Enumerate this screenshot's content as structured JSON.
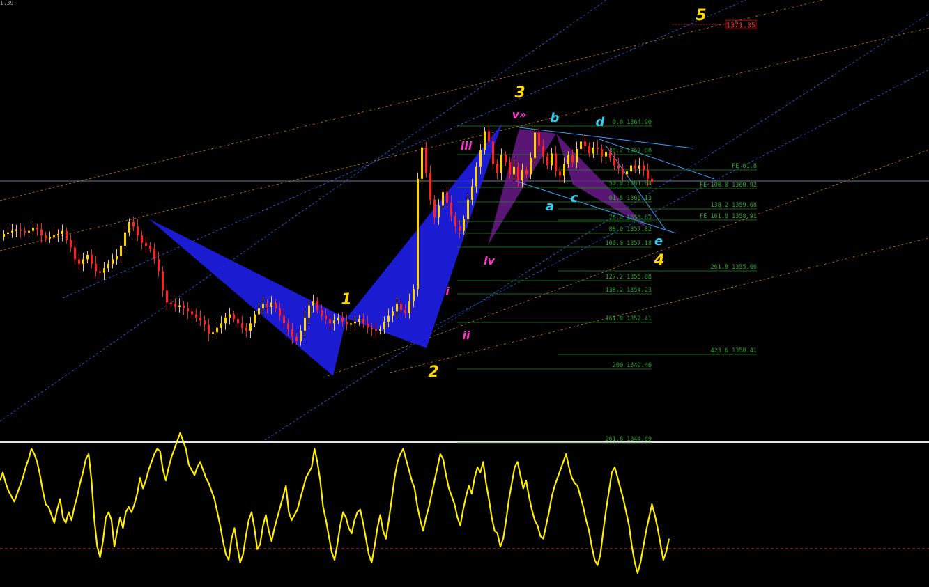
{
  "top_left_text": "1.39",
  "price_marker": {
    "label": "1371.35",
    "color": "#c00000"
  },
  "colors": {
    "background": "#000000",
    "bull_candle": "#ffd200",
    "bear_candle": "#ff2020",
    "fib_line": "#1f8a1f",
    "fib_text": "#2aa62a",
    "channel_blue": "#1f6fff",
    "channel_orange": "#c97a1a",
    "triangle_blue": "#1e1ee8",
    "triangle_purple": "#6a1a8a",
    "wave_major": "#ffd700",
    "wave_minor": "#ff33cc",
    "wave_abc": "#33ccee",
    "oscillator": "#ffee00",
    "oscillator_zero": "#c0306a"
  },
  "wave_labels": {
    "major": [
      "1",
      "2",
      "3",
      "4",
      "5"
    ],
    "minor": [
      "i",
      "ii",
      "iii",
      "iv",
      "v»"
    ],
    "abcde": [
      "a",
      "b",
      "c",
      "d",
      "e"
    ]
  },
  "fib_levels_left": [
    "0.0 1364.90",
    "38.2 1362.08",
    "50.0 1361.04",
    "61.8 1360.13",
    "76.4 1358.83",
    "88.6 1357.82",
    "100.0 1357.18",
    "127.2 1355.08",
    "138.2 1354.23",
    "161.8 1352.41",
    "200 1349.46",
    "261.8 1344.69"
  ],
  "fib_levels_right": [
    "FE 61.8",
    "FE 100.0 1360.92",
    "138.2 1359.68",
    "FE 161.8 1358.91",
    "261.8 1355.66",
    "423.6 1350.41"
  ],
  "chart_data": [
    {
      "type": "candlestick",
      "title": "",
      "xlabel": "",
      "ylabel": "",
      "ylim": [
        1343.6,
        1373.0
      ],
      "grid": false,
      "price_marker": 1371.35,
      "pivots": [
        {
          "label": "1",
          "value": 1352.8
        },
        {
          "label": "2",
          "value": 1349.9
        },
        {
          "label": "iii",
          "value": 1363.1
        },
        {
          "label": "v»",
          "value": 1364.9
        },
        {
          "label": "4",
          "value": 1357.18
        }
      ],
      "fib_retracement": [
        {
          "ratio": 0.0,
          "price": 1364.9
        },
        {
          "ratio": 38.2,
          "price": 1362.08
        },
        {
          "ratio": 50.0,
          "price": 1361.04
        },
        {
          "ratio": 61.8,
          "price": 1360.13
        },
        {
          "ratio": 76.4,
          "price": 1358.83
        },
        {
          "ratio": 88.6,
          "price": 1357.82
        },
        {
          "ratio": 100.0,
          "price": 1357.18
        },
        {
          "ratio": 127.2,
          "price": 1355.08
        },
        {
          "ratio": 138.2,
          "price": 1354.23
        },
        {
          "ratio": 161.8,
          "price": 1352.41
        },
        {
          "ratio": 200,
          "price": 1349.46
        },
        {
          "ratio": 261.8,
          "price": 1344.69
        }
      ],
      "fib_expansion": [
        {
          "ratio": 61.8,
          "price": null
        },
        {
          "ratio": 100.0,
          "price": 1360.92
        },
        {
          "ratio": 138.2,
          "price": 1359.68
        },
        {
          "ratio": 161.8,
          "price": 1358.91
        },
        {
          "ratio": 261.8,
          "price": 1355.66
        },
        {
          "ratio": 423.6,
          "price": 1350.41
        }
      ],
      "close_series": [
        1357.3,
        1357.4,
        1357.5,
        1357.6,
        1357.5,
        1357.4,
        1357.5,
        1357.7,
        1357.6,
        1357.2,
        1357.0,
        1357.1,
        1357.2,
        1357.3,
        1357.5,
        1356.9,
        1356.4,
        1355.6,
        1355.3,
        1355.6,
        1355.9,
        1355.3,
        1354.8,
        1354.7,
        1355.0,
        1355.3,
        1355.6,
        1355.8,
        1356.5,
        1357.4,
        1358.1,
        1357.8,
        1357.2,
        1356.7,
        1356.5,
        1356.3,
        1355.6,
        1354.8,
        1353.5,
        1352.7,
        1352.6,
        1352.4,
        1352.5,
        1352.3,
        1352.1,
        1351.9,
        1351.7,
        1351.5,
        1351.2,
        1350.6,
        1350.7,
        1351.0,
        1351.3,
        1351.7,
        1351.9,
        1351.6,
        1351.3,
        1351.0,
        1350.8,
        1351.3,
        1351.9,
        1352.3,
        1352.6,
        1352.4,
        1352.7,
        1352.3,
        1351.8,
        1351.3,
        1350.9,
        1350.4,
        1350.1,
        1350.8,
        1351.7,
        1352.5,
        1352.8,
        1352.2,
        1351.8,
        1351.6,
        1351.3,
        1351.5,
        1351.7,
        1351.4,
        1351.2,
        1351.3,
        1351.4,
        1351.6,
        1351.3,
        1351.0,
        1350.9,
        1350.8,
        1350.9,
        1351.4,
        1351.8,
        1352.1,
        1352.6,
        1352.2,
        1352.0,
        1352.8,
        1353.6,
        1361.0,
        1363.1,
        1361.4,
        1359.6,
        1358.4,
        1359.2,
        1360.1,
        1359.4,
        1358.5,
        1357.8,
        1357.5,
        1358.3,
        1359.6,
        1360.5,
        1361.8,
        1362.9,
        1364.2,
        1363.5,
        1362.0,
        1361.4,
        1362.6,
        1362.1,
        1361.3,
        1361.8,
        1360.9,
        1361.6,
        1361.3,
        1362.4,
        1364.1,
        1363.2,
        1362.5,
        1361.9,
        1362.7,
        1361.5,
        1361.2,
        1362.0,
        1362.6,
        1362.1,
        1363.0,
        1363.5,
        1363.2,
        1362.7,
        1363.1,
        1363.0,
        1362.5,
        1362.8,
        1362.4,
        1361.9,
        1361.7,
        1361.3,
        1361.5,
        1361.9,
        1361.7,
        1361.9,
        1361.6,
        1361.0,
        1360.8
      ]
    },
    {
      "type": "line",
      "title": "",
      "zero_line": 0,
      "ylim": [
        -70,
        80
      ],
      "series": [
        {
          "values": [
            20,
            26,
            18,
            12,
            8,
            4,
            10,
            16,
            22,
            30,
            36,
            44,
            40,
            34,
            24,
            12,
            2,
            0,
            -6,
            -12,
            -2,
            6,
            -8,
            -12,
            -4,
            -10,
            0,
            8,
            18,
            26,
            36,
            40,
            20,
            -10,
            -30,
            -38,
            -26,
            -8,
            -4,
            -10,
            -30,
            -18,
            -8,
            -16,
            -4,
            0,
            -4,
            2,
            10,
            22,
            14,
            20,
            28,
            34,
            40,
            44,
            42,
            28,
            20,
            30,
            38,
            44,
            50,
            56,
            50,
            44,
            32,
            28,
            24,
            30,
            34,
            28,
            22,
            18,
            12,
            6,
            -4,
            -14,
            -26,
            -36,
            -40,
            -24,
            -16,
            -30,
            -42,
            -36,
            -22,
            -10,
            -4,
            -16,
            -32,
            -28,
            -14,
            -6,
            -18,
            -26,
            -16,
            -8,
            0,
            8,
            16,
            -4,
            -10,
            -6,
            -2,
            6,
            14,
            22,
            26,
            30,
            44,
            34,
            20,
            0,
            -10,
            -22,
            -34,
            -40,
            -28,
            -14,
            -4,
            -8,
            -16,
            -20,
            -10,
            -4,
            -2,
            -12,
            -24,
            -36,
            -42,
            -30,
            -16,
            -6,
            -18,
            -24,
            -10,
            6,
            22,
            34,
            40,
            44,
            36,
            28,
            20,
            14,
            0,
            -10,
            -18,
            -8,
            0,
            10,
            20,
            30,
            40,
            36,
            24,
            14,
            8,
            2,
            -8,
            -14,
            -2,
            8,
            16,
            10,
            22,
            30,
            26,
            34,
            18,
            6,
            -8,
            -18,
            -20,
            -30,
            -24,
            -10,
            6,
            18,
            30,
            34,
            24,
            14,
            20,
            8,
            -2,
            -10,
            -14,
            -22,
            -24,
            -14,
            -4,
            8,
            16,
            22,
            28,
            34,
            40,
            30,
            22,
            18,
            16,
            8,
            0,
            -10,
            -18,
            -30,
            -40,
            -44,
            -36,
            -18,
            -2,
            12,
            26,
            30,
            22,
            14,
            6,
            -4,
            -14,
            -30,
            -42,
            -50,
            -42,
            -30,
            -18,
            -8,
            2,
            -6,
            -16,
            -28,
            -40,
            -34,
            -24
          ]
        }
      ]
    }
  ]
}
